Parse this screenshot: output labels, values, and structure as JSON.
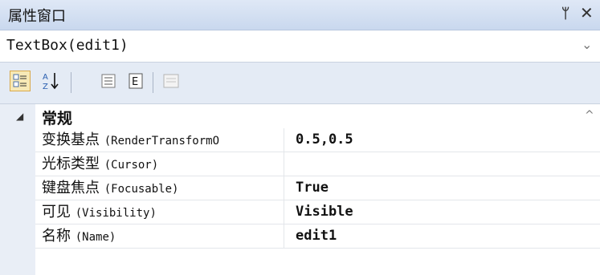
{
  "window": {
    "title": "属性窗口",
    "pin_glyph": "ᛘ",
    "close_glyph": "✕"
  },
  "object_selector": {
    "value": "TextBox(edit1)",
    "dropdown_glyph": "⌄"
  },
  "toolbar": {
    "buttons": [
      {
        "icon": "categorized-icon",
        "active": true
      },
      {
        "icon": "sort-alphabetical-icon",
        "active": false
      },
      {
        "icon": "properties-icon",
        "active": false
      },
      {
        "icon": "events-icon",
        "active": false
      },
      {
        "icon": "property-pages-icon",
        "active": false,
        "disabled": true
      }
    ]
  },
  "grid": {
    "category": {
      "label": "常规",
      "caret": "◢"
    },
    "rows": [
      {
        "cn": "变换基点",
        "en": "(RenderTransformO",
        "value": "0.5,0.5"
      },
      {
        "cn": "光标类型",
        "en": "(Cursor)",
        "value": ""
      },
      {
        "cn": "键盘焦点",
        "en": "(Focusable)",
        "value": "True"
      },
      {
        "cn": "可见",
        "en": "(Visibility)",
        "value": "Visible"
      },
      {
        "cn": "名称",
        "en": "(Name)",
        "value": "edit1"
      }
    ]
  },
  "colors": {
    "titlebar": "#c9d8ee",
    "toolbar": "#e4ebf5",
    "active_button": "#f7e9b6"
  }
}
